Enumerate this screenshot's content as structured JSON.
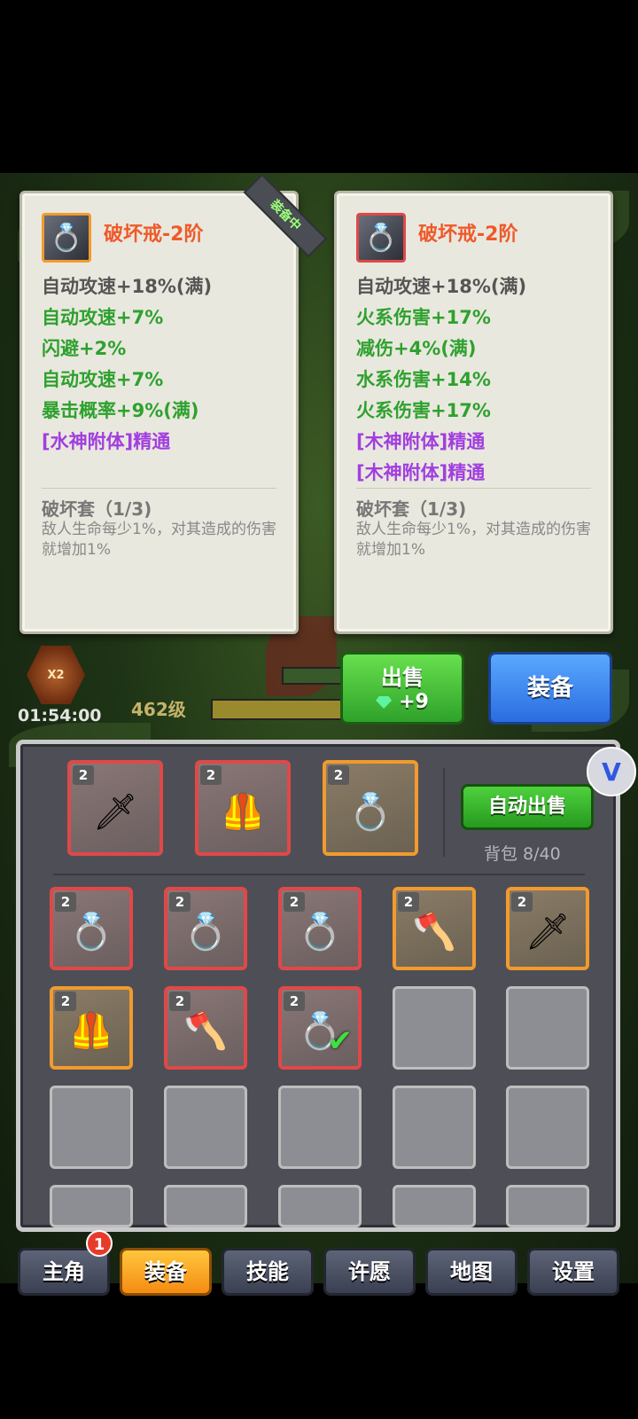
{
  "compare": {
    "equipped_label": "装备中",
    "left": {
      "name": "破坏戒-2阶",
      "stats": [
        {
          "text": "自动攻速+18%(满)",
          "color": "gray"
        },
        {
          "text": "自动攻速+7%",
          "color": "green"
        },
        {
          "text": "闪避+2%",
          "color": "green"
        },
        {
          "text": "自动攻速+7%",
          "color": "green"
        },
        {
          "text": "暴击概率+9%(满)",
          "color": "green"
        },
        {
          "text": "[水神附体]精通",
          "color": "purple"
        }
      ],
      "set_title": "破坏套（1/3)",
      "set_desc": "敌人生命每少1%，对其造成的伤害就增加1%"
    },
    "right": {
      "name": "破坏戒-2阶",
      "stats": [
        {
          "text": "自动攻速+18%(满)",
          "color": "gray"
        },
        {
          "text": "火系伤害+17%",
          "color": "green"
        },
        {
          "text": "减伤+4%(满)",
          "color": "green"
        },
        {
          "text": "水系伤害+14%",
          "color": "green"
        },
        {
          "text": "火系伤害+17%",
          "color": "green"
        },
        {
          "text": "[木神附体]精通",
          "color": "purple"
        },
        {
          "text": "[木神附体]精通",
          "color": "purple"
        }
      ],
      "set_title": "破坏套（1/3)",
      "set_desc": "敌人生命每少1%，对其造成的伤害就增加1%"
    }
  },
  "hud": {
    "multiplier": "X2",
    "timer": "01:54:00",
    "level": "462级"
  },
  "actions": {
    "sell_label": "出售",
    "sell_price": "+9",
    "equip_label": "装备"
  },
  "inventory": {
    "auto_sell_label": "自动出售",
    "bag_label": "背包 8/40",
    "equipped_slots": [
      {
        "level": "2",
        "icon": "sword-icon",
        "glyph": "🗡",
        "rarity": "red"
      },
      {
        "level": "2",
        "icon": "armor-icon",
        "glyph": "🦺",
        "rarity": "red"
      },
      {
        "level": "2",
        "icon": "ring-icon",
        "glyph": "💍",
        "rarity": "orange"
      }
    ],
    "items": [
      {
        "level": "2",
        "icon": "ring-icon",
        "glyph": "💍",
        "rarity": "red"
      },
      {
        "level": "2",
        "icon": "ring-icon",
        "glyph": "💍",
        "rarity": "red"
      },
      {
        "level": "2",
        "icon": "ring-icon",
        "glyph": "💍",
        "rarity": "red"
      },
      {
        "level": "2",
        "icon": "axe-icon",
        "glyph": "🪓",
        "rarity": "orange"
      },
      {
        "level": "2",
        "icon": "sword-icon",
        "glyph": "🗡",
        "rarity": "orange"
      },
      {
        "level": "2",
        "icon": "armor-icon",
        "glyph": "🦺",
        "rarity": "orange"
      },
      {
        "level": "2",
        "icon": "axe-icon",
        "glyph": "🪓",
        "rarity": "red"
      },
      {
        "level": "2",
        "icon": "ring-icon",
        "glyph": "💍",
        "rarity": "red",
        "selected": true
      }
    ]
  },
  "tabs": [
    {
      "label": "主角",
      "badge": "1"
    },
    {
      "label": "装备",
      "active": true
    },
    {
      "label": "技能"
    },
    {
      "label": "许愿"
    },
    {
      "label": "地图"
    },
    {
      "label": "设置"
    }
  ]
}
